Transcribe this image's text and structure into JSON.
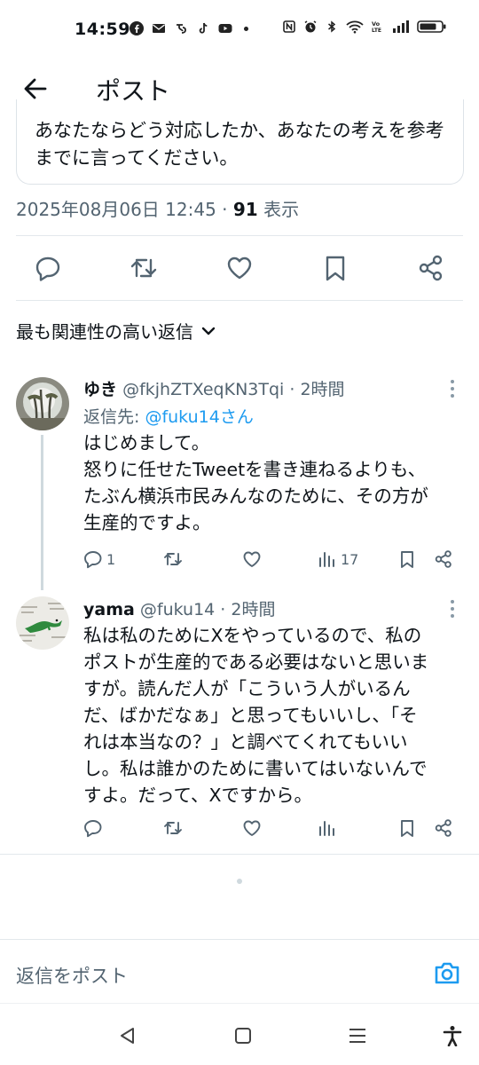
{
  "status_bar": {
    "time": "14:59",
    "left_icons": [
      "facebook-icon",
      "mail-icon",
      "app-icon",
      "tiktok-icon",
      "youtube-icon",
      "dot-icon"
    ],
    "right_icons": [
      "nfc-icon",
      "alarm-icon",
      "bluetooth-icon",
      "wifi-icon",
      "volte-icon",
      "signal-icon",
      "battery-icon"
    ]
  },
  "header": {
    "title": "ポスト"
  },
  "quoted_post": {
    "text": "あなたならどう対応したか、あなたの考えを参考までに言ってください。"
  },
  "post_meta": {
    "datetime": "2025年08月06日 12:45",
    "separator": " · ",
    "views_count": "91",
    "views_label": " 表示"
  },
  "sort": {
    "label": "最も関連性の高い返信"
  },
  "replies": [
    {
      "name": "ゆき",
      "handle": "@fkjhZTXeqKN3Tqi",
      "time": " · 2時間",
      "reply_to_prefix": "返信先: ",
      "reply_to_mention": "@fuku14さん",
      "text_lines": [
        "はじめまして。",
        "怒りに任せたTweetを書き連ねるよりも、",
        "たぶん横浜市民みんなのために、その方が",
        "生産的ですよ。"
      ],
      "reply_count": "1",
      "views": "17"
    },
    {
      "name": "yama",
      "handle": "@fuku14",
      "time": " · 2時間",
      "text_lines": [
        "私は私のためにXをやっているので、私の",
        "ポストが生産的である必要はないと思いま",
        "すが。読んだ人が「こういう人がいるん",
        "だ、ばかだなぁ」と思ってもいいし、「そ",
        "れは本当なの？」と調べてくれてもいい",
        "し。私は誰かのために書いてはいないんで",
        "すよ。だって、Xですから。"
      ]
    }
  ],
  "compose": {
    "placeholder": "返信をポスト"
  },
  "colors": {
    "accent": "#1d9bf0",
    "text": "#0f1419",
    "secondary": "#536471"
  }
}
